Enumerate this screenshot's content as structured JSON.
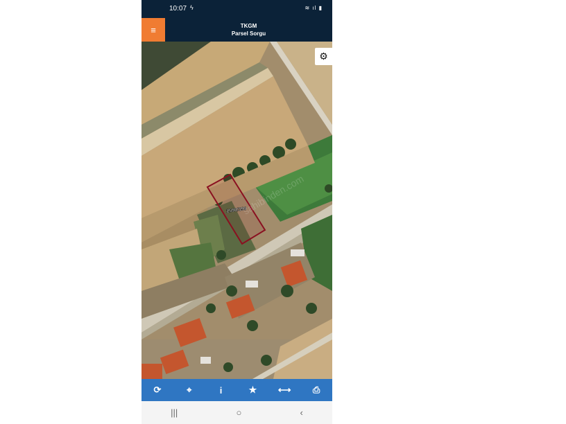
{
  "status": {
    "time": "10:07",
    "charge_icon": "bolt-icon",
    "right_icons": "≋ ıl ▮"
  },
  "header": {
    "menu_icon": "≡",
    "title": "TKGM",
    "subtitle": "Parsel Sorgu"
  },
  "map": {
    "parcel_label": "1590/399",
    "watermark": "sahibinden.com",
    "settings_icon": "⚙"
  },
  "toolbar": {
    "refresh": "⟳",
    "locate": "⌖",
    "info": "i",
    "favorite": "★",
    "measure": "⟷",
    "print": "⎙"
  },
  "nav": {
    "recents": "|||",
    "home": "○",
    "back": "‹"
  },
  "colors": {
    "header_bg": "#0b2238",
    "accent": "#f07c32",
    "toolbar_bg": "#2f76c2",
    "parcel_outline": "#8a1020"
  }
}
